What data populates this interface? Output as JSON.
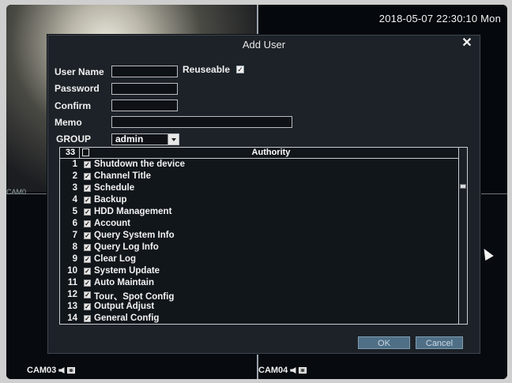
{
  "screen": {
    "datetime": "2018-05-07 22:30:10 Mon",
    "cam_labels": [
      {
        "label": "CAM03"
      },
      {
        "label": "CAM04"
      }
    ],
    "side_text": "CAM0"
  },
  "dialog": {
    "title": "Add User",
    "close_icon": "✕",
    "fields": {
      "user_name_label": "User Name",
      "user_name_value": "",
      "reuseable_label": "Reuseable",
      "reuseable_checked": true,
      "password_label": "Password",
      "password_value": "",
      "confirm_label": "Confirm",
      "confirm_value": "",
      "memo_label": "Memo",
      "memo_value": "",
      "group_label": "GROUP",
      "group_value": "admin"
    },
    "authority": {
      "count": "33",
      "header": "Authority",
      "rows": [
        {
          "index": "1",
          "label": "Shutdown the device",
          "checked": true
        },
        {
          "index": "2",
          "label": "Channel Title",
          "checked": true
        },
        {
          "index": "3",
          "label": "Schedule",
          "checked": true
        },
        {
          "index": "4",
          "label": "Backup",
          "checked": true
        },
        {
          "index": "5",
          "label": "HDD Management",
          "checked": true
        },
        {
          "index": "6",
          "label": "Account",
          "checked": true
        },
        {
          "index": "7",
          "label": "Query System Info",
          "checked": true
        },
        {
          "index": "8",
          "label": "Query Log Info",
          "checked": true
        },
        {
          "index": "9",
          "label": "Clear Log",
          "checked": true
        },
        {
          "index": "10",
          "label": "System Update",
          "checked": true
        },
        {
          "index": "11",
          "label": "Auto Maintain",
          "checked": true
        },
        {
          "index": "12",
          "label": "Tour、Spot Config",
          "checked": true
        },
        {
          "index": "13",
          "label": "Output Adjust",
          "checked": true
        },
        {
          "index": "14",
          "label": "General Config",
          "checked": true
        }
      ]
    },
    "buttons": {
      "ok": "OK",
      "cancel": "Cancel"
    }
  },
  "colors": {
    "dialog_bg": "#1d2228",
    "button_bg": "#4f6f86"
  }
}
